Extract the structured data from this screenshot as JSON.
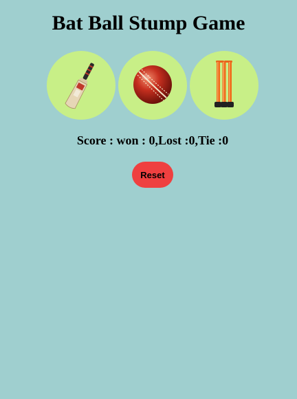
{
  "app": {
    "title": "Bat Ball Stump Game"
  },
  "choices": [
    {
      "name": "Bat",
      "icon": "cricket-bat-icon",
      "bg_color": "#c8ef87"
    },
    {
      "name": "Ball",
      "icon": "cricket-ball-icon",
      "bg_color": "#c8ef87"
    },
    {
      "name": "Stump",
      "icon": "cricket-stumps-icon",
      "bg_color": "#c8ef87"
    }
  ],
  "score": {
    "text": "Score : won : 0,Lost :0,Tie :0"
  },
  "reset": {
    "label": "Reset",
    "color": "#ef4040"
  },
  "colors": {
    "background": "#9fcfcf",
    "choice_bg": "#c8ef87"
  }
}
